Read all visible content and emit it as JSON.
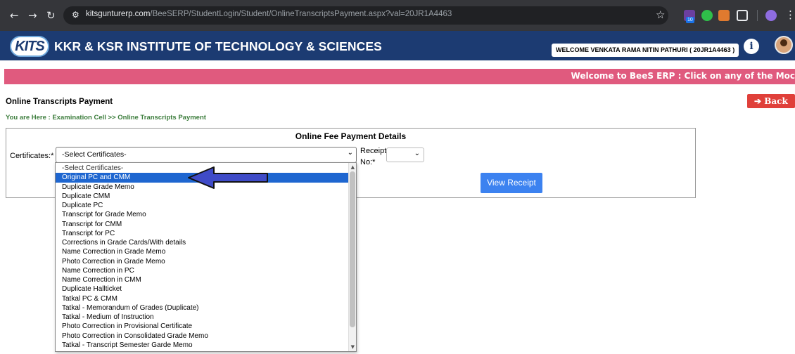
{
  "browser": {
    "url_domain": "kitsgunturerp.com",
    "url_path": "/BeeSERP/StudentLogin/Student/OnlineTranscriptsPayment.aspx?val=20JR1A4463",
    "ext_badge": "10"
  },
  "header": {
    "logo_text": "KITS",
    "institute": "KKR & KSR INSTITUTE OF TECHNOLOGY & SCIENCES",
    "welcome": "WELCOME VENKATA RAMA NITIN PATHURI ( 20JR1A4463 )",
    "info_glyph": "i"
  },
  "marquee": "Welcome to BeeS ERP : Click on any of the Moc",
  "page": {
    "title": "Online Transcripts Payment",
    "breadcrumb": "You are Here : Examination Cell >> Online Transcripts Payment",
    "back_label": "Back"
  },
  "form": {
    "panel_title": "Online Fee Payment Details",
    "cert_label": "Certificates:*",
    "selected": "-Select Certificates-",
    "receipt_label_1": "Receipt",
    "receipt_label_2": "No:*",
    "view_receipt": "View Receipt"
  },
  "dropdown": {
    "options": [
      "-Select Certificates-",
      "Original PC and CMM",
      "Duplicate Grade Memo",
      "Duplicate CMM",
      "Duplicate PC",
      "Transcript for Grade Memo",
      "Transcript for CMM",
      "Transcript for PC",
      "Corrections in Grade Cards/With details",
      "Name Correction in Grade Memo",
      "Photo Correction in Grade Memo",
      "Name Correction in PC",
      "Name Correction in CMM",
      "Duplicate Hallticket",
      "Tatkal PC & CMM",
      "Tatkal - Memorandum of Grades (Duplicate)",
      "Tatkal - Medium of Instruction",
      "Photo Correction in Provisional Certificate",
      "Photo Correction in Consolidated Grade Memo",
      "Tatkal - Transcript Semester Garde Memo"
    ],
    "highlighted_index": 1
  },
  "colors": {
    "header_bg": "#1c3b72",
    "marquee_bg": "#e05a7e",
    "back_btn": "#e0403a",
    "view_btn": "#3c82f0",
    "highlight": "#1e66d0",
    "arrow_fill": "#3f4bc8"
  }
}
